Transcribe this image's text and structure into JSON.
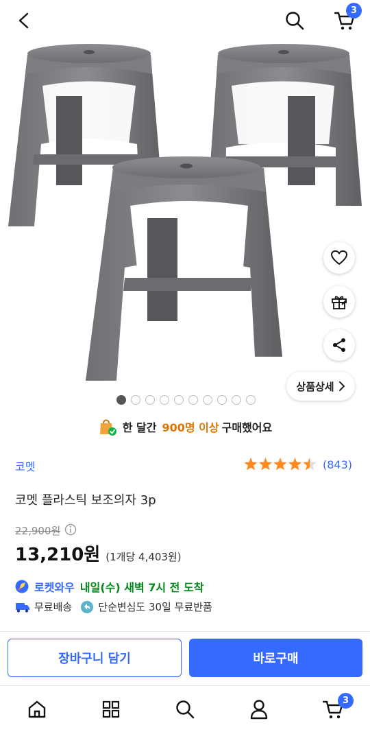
{
  "topbar": {
    "cart_count": "3"
  },
  "gallery": {
    "detail_label": "상품상세",
    "total_images": 10,
    "active_index": 0
  },
  "notice": {
    "prefix": "한 달간",
    "highlight": "900명 이상",
    "suffix": "구매했어요"
  },
  "product": {
    "brand": "코멧",
    "title": "코멧 플라스틱 보조의자 3p",
    "original_price": "22,900원",
    "price": "13,210원",
    "unit_price": "(1개당 4,403원)",
    "rating": 4.5,
    "review_count": "(843)"
  },
  "delivery": {
    "rocket_label": "로켓와우",
    "arrival": "내일(수) 새벽 7시 전 도착",
    "free_shipping": "무료배송",
    "free_return": "단순변심도 30일 무료반품"
  },
  "actions": {
    "add_to_cart": "장바구니 담기",
    "buy_now": "바로구매"
  },
  "bottom_nav": {
    "cart_count": "3"
  },
  "colors": {
    "accent": "#346aff",
    "star": "#ff8a1f",
    "highlight": "#e07400",
    "arrival": "#00891a"
  }
}
